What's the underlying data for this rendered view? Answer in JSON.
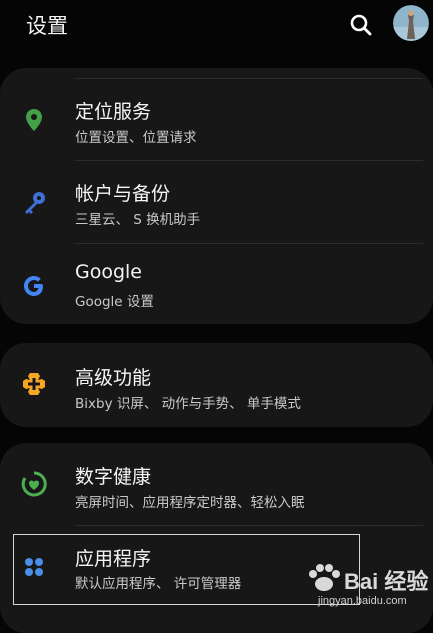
{
  "header": {
    "title": "设置"
  },
  "sections": {
    "location": {
      "title": "定位服务",
      "subtitle": "位置设置、位置请求"
    },
    "accounts": {
      "title": "帐户与备份",
      "subtitle": "三星云、 S 换机助手"
    },
    "google": {
      "title": "Google",
      "subtitle": "Google 设置"
    },
    "advanced": {
      "title": "高级功能",
      "subtitle": "Bixby 识屏、 动作与手势、 单手模式"
    },
    "wellbeing": {
      "title": "数字健康",
      "subtitle": "亮屏时间、应用程序定时器、轻松入眠"
    },
    "apps": {
      "title": "应用程序",
      "subtitle": "默认应用程序、 许可管理器"
    }
  },
  "watermark": {
    "brand": "Bai 经验",
    "url": "jingyan.baidu.com"
  },
  "colors": {
    "background": "#050505",
    "card": "#171717",
    "location_icon": "#43a047",
    "accounts_icon": "#3f6fd8",
    "advanced_icon": "#f5a623",
    "wellbeing_icon": "#4caf50",
    "apps_icon": "#4a8ee8"
  },
  "icons": {
    "header": [
      "search-icon",
      "avatar"
    ],
    "rows": [
      "location-pin-icon",
      "key-icon",
      "google-g-icon",
      "puzzle-plus-icon",
      "wellbeing-heart-icon",
      "apps-dots-icon"
    ]
  }
}
